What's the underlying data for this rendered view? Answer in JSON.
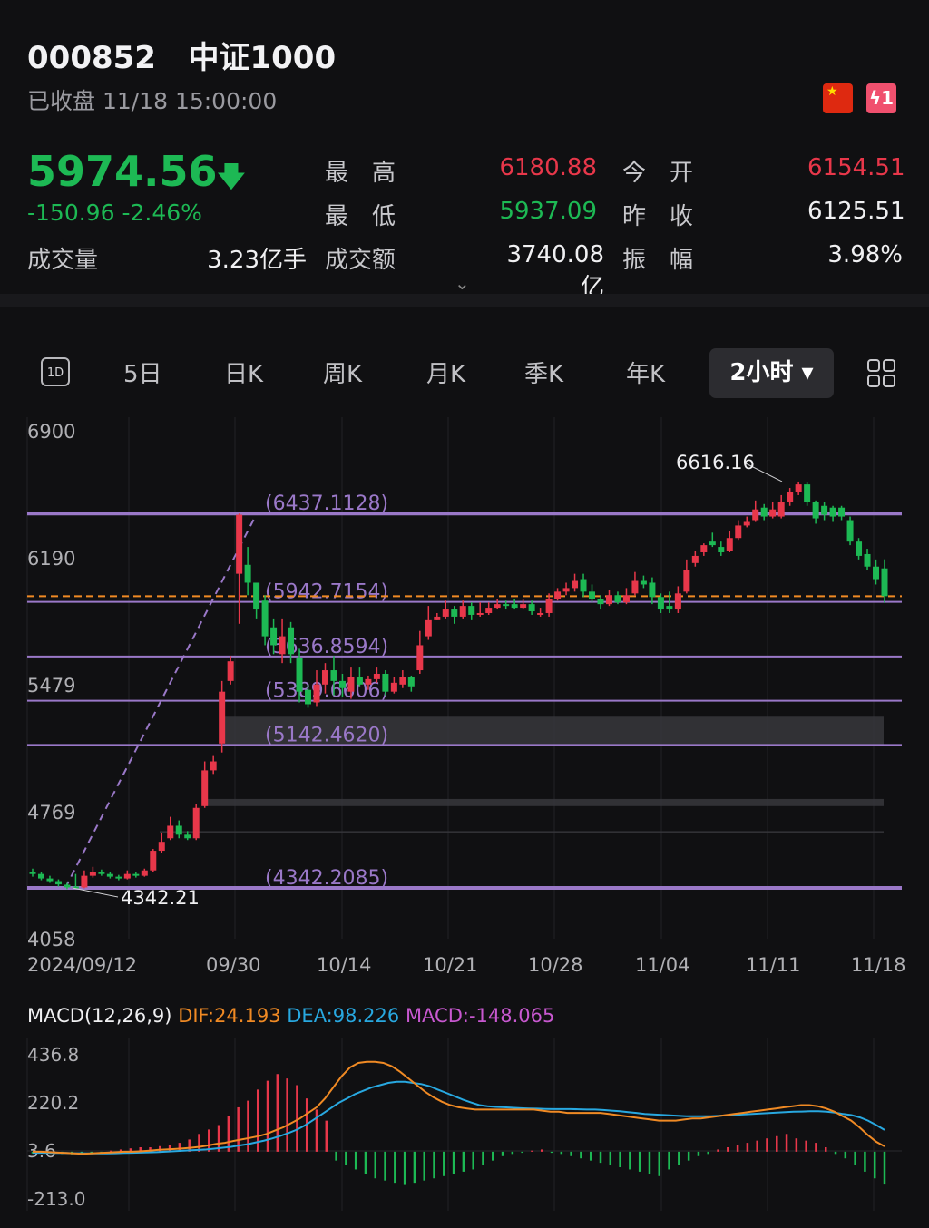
{
  "header": {
    "code": "000852",
    "name": "中证1000",
    "status": "已收盘 11/18 15:00:00",
    "hot_badge": "ϟ1"
  },
  "quote": {
    "price": "5974.56",
    "change": "-150.96 -2.46%",
    "stats": [
      {
        "label": "最　高",
        "value": "6180.88",
        "color": "red"
      },
      {
        "label": "今　开",
        "value": "6154.51",
        "color": "red"
      },
      {
        "label": "最　低",
        "value": "5937.09",
        "color": "green"
      },
      {
        "label": "昨　收",
        "value": "6125.51",
        "color": "white"
      },
      {
        "label": "成交量",
        "value": "3.23亿手",
        "color": "white"
      },
      {
        "label": "成交额",
        "value": "3740.08亿",
        "color": "white"
      },
      {
        "label": "振　幅",
        "value": "3.98%",
        "color": "white"
      }
    ]
  },
  "tabs": {
    "icon_1d": "1D",
    "items": [
      "5日",
      "日K",
      "周K",
      "月K",
      "季K",
      "年K"
    ],
    "selected": "2小时"
  },
  "colors": {
    "up": "#e8374a",
    "down": "#1db954",
    "dif": "#f08a24",
    "dea": "#28a8e0",
    "macd": "#c858d0",
    "level": "#9a78c8",
    "close_line": "#f08a24"
  },
  "chart_data": {
    "type": "candlestick",
    "y_ticks": [
      "6900",
      "6190",
      "5479",
      "4769",
      "4058"
    ],
    "ylim": [
      4058,
      6900
    ],
    "x_ticks": [
      "2024/09/12",
      "09/30",
      "10/14",
      "10/21",
      "10/28",
      "11/04",
      "11/11",
      "11/18"
    ],
    "high_label": "6616.16",
    "low_label": "4342.21",
    "current_price": 5974.56,
    "levels": [
      {
        "label": "(6437.1128)",
        "value": 6437.1128
      },
      {
        "label": "(5942.7154)",
        "value": 5942.7154
      },
      {
        "label": "(5636.8594)",
        "value": 5636.8594
      },
      {
        "label": "(5389.6606)",
        "value": 5389.6606
      },
      {
        "label": "(5142.4620)",
        "value": 5142.462
      },
      {
        "label": "(4342.2085)",
        "value": 4342.2085
      }
    ],
    "candles": [
      [
        4430,
        4420,
        4450,
        4405
      ],
      [
        4420,
        4395,
        4430,
        4385
      ],
      [
        4395,
        4380,
        4410,
        4370
      ],
      [
        4380,
        4362,
        4390,
        4350
      ],
      [
        4360,
        4345,
        4370,
        4335
      ],
      [
        4350,
        4342,
        4420,
        4342
      ],
      [
        4345,
        4410,
        4440,
        4340
      ],
      [
        4410,
        4430,
        4460,
        4400
      ],
      [
        4430,
        4420,
        4445,
        4410
      ],
      [
        4420,
        4405,
        4430,
        4395
      ],
      [
        4405,
        4395,
        4415,
        4385
      ],
      [
        4395,
        4420,
        4440,
        4390
      ],
      [
        4420,
        4410,
        4430,
        4400
      ],
      [
        4410,
        4440,
        4450,
        4405
      ],
      [
        4440,
        4550,
        4560,
        4430
      ],
      [
        4550,
        4600,
        4650,
        4540
      ],
      [
        4620,
        4690,
        4740,
        4610
      ],
      [
        4690,
        4640,
        4720,
        4620
      ],
      [
        4640,
        4620,
        4660,
        4610
      ],
      [
        4620,
        4790,
        4810,
        4610
      ],
      [
        4800,
        5000,
        5050,
        4790
      ],
      [
        5000,
        5050,
        5080,
        4980
      ],
      [
        5150,
        5440,
        5500,
        5100
      ],
      [
        5500,
        5610,
        5640,
        5480
      ],
      [
        6100,
        6430,
        6437,
        5820
      ],
      [
        6150,
        6050,
        6250,
        5980
      ],
      [
        6050,
        5900,
        6000,
        5850
      ],
      [
        5950,
        5750,
        5980,
        5700
      ],
      [
        5800,
        5700,
        5850,
        5650
      ],
      [
        5650,
        5750,
        5850,
        5600
      ],
      [
        5800,
        5650,
        5830,
        5600
      ],
      [
        5630,
        5440,
        5680,
        5380
      ],
      [
        5450,
        5370,
        5480,
        5350
      ],
      [
        5380,
        5480,
        5560,
        5360
      ],
      [
        5480,
        5560,
        5600,
        5430
      ],
      [
        5560,
        5500,
        5640,
        5420
      ],
      [
        5500,
        5460,
        5540,
        5410
      ],
      [
        5440,
        5520,
        5580,
        5400
      ],
      [
        5520,
        5480,
        5580,
        5470
      ],
      [
        5480,
        5510,
        5530,
        5450
      ],
      [
        5510,
        5540,
        5580,
        5490
      ],
      [
        5540,
        5440,
        5560,
        5420
      ],
      [
        5440,
        5490,
        5520,
        5430
      ],
      [
        5480,
        5520,
        5560,
        5460
      ],
      [
        5520,
        5470,
        5530,
        5440
      ],
      [
        5560,
        5700,
        5780,
        5540
      ],
      [
        5750,
        5840,
        5920,
        5730
      ],
      [
        5840,
        5860,
        5880,
        5840
      ],
      [
        5860,
        5900,
        5950,
        5850
      ],
      [
        5900,
        5860,
        5920,
        5820
      ],
      [
        5860,
        5920,
        5950,
        5850
      ],
      [
        5920,
        5870,
        5940,
        5840
      ],
      [
        5870,
        5880,
        5940,
        5860
      ],
      [
        5880,
        5910,
        5940,
        5870
      ],
      [
        5910,
        5930,
        5960,
        5900
      ],
      [
        5930,
        5920,
        5950,
        5900
      ],
      [
        5930,
        5910,
        5960,
        5900
      ],
      [
        5910,
        5930,
        5960,
        5900
      ],
      [
        5930,
        5890,
        5950,
        5870
      ],
      [
        5870,
        5880,
        5910,
        5860
      ],
      [
        5880,
        5960,
        5990,
        5860
      ],
      [
        5960,
        6000,
        6020,
        5950
      ],
      [
        6000,
        6020,
        6050,
        5980
      ],
      [
        6020,
        6060,
        6100,
        6000
      ],
      [
        6070,
        6000,
        6100,
        5970
      ],
      [
        6000,
        5960,
        6040,
        5940
      ],
      [
        5960,
        5930,
        5980,
        5900
      ],
      [
        5930,
        5980,
        6010,
        5920
      ],
      [
        5980,
        5940,
        6000,
        5930
      ],
      [
        5940,
        5980,
        6020,
        5930
      ],
      [
        5990,
        6060,
        6110,
        5980
      ],
      [
        6060,
        6040,
        6090,
        6020
      ],
      [
        6050,
        5970,
        6080,
        5930
      ],
      [
        5970,
        5900,
        5990,
        5880
      ],
      [
        5920,
        5900,
        6000,
        5880
      ],
      [
        5900,
        5990,
        6030,
        5880
      ],
      [
        6000,
        6120,
        6180,
        5990
      ],
      [
        6160,
        6200,
        6230,
        6140
      ],
      [
        6220,
        6260,
        6270,
        6200
      ],
      [
        6280,
        6260,
        6330,
        6250
      ],
      [
        6250,
        6220,
        6280,
        6200
      ],
      [
        6230,
        6300,
        6340,
        6220
      ],
      [
        6300,
        6370,
        6400,
        6290
      ],
      [
        6370,
        6390,
        6420,
        6360
      ],
      [
        6400,
        6460,
        6510,
        6390
      ],
      [
        6470,
        6420,
        6490,
        6400
      ],
      [
        6420,
        6460,
        6500,
        6410
      ],
      [
        6420,
        6500,
        6540,
        6410
      ],
      [
        6500,
        6560,
        6580,
        6480
      ],
      [
        6560,
        6600,
        6616,
        6540
      ],
      [
        6600,
        6500,
        6610,
        6480
      ],
      [
        6500,
        6410,
        6510,
        6380
      ],
      [
        6480,
        6430,
        6500,
        6400
      ],
      [
        6470,
        6420,
        6480,
        6390
      ],
      [
        6470,
        6420,
        6480,
        6400
      ],
      [
        6400,
        6280,
        6420,
        6260
      ],
      [
        6280,
        6200,
        6300,
        6180
      ],
      [
        6210,
        6140,
        6240,
        6120
      ],
      [
        6140,
        6070,
        6180,
        6040
      ],
      [
        6130,
        5974.56,
        6180.88,
        5937.09
      ]
    ],
    "macd": {
      "label": "MACD(12,26,9)",
      "dif_label": "DIF:24.193",
      "dea_label": "DEA:98.226",
      "macd_label": "MACD:-148.065",
      "y_ticks": [
        "436.8",
        "220.2",
        "3.6",
        "-213.0"
      ],
      "ylim": [
        -213.0,
        436.8
      ],
      "dif": [
        0,
        0,
        -2,
        -4,
        -6,
        -8,
        -10,
        -8,
        -6,
        -4,
        -2,
        0,
        0,
        2,
        5,
        8,
        10,
        12,
        15,
        18,
        22,
        28,
        35,
        40,
        48,
        55,
        62,
        70,
        80,
        95,
        110,
        130,
        150,
        175,
        200,
        240,
        290,
        340,
        380,
        400,
        405,
        405,
        400,
        385,
        360,
        330,
        300,
        270,
        245,
        225,
        210,
        200,
        195,
        190,
        190,
        190,
        190,
        190,
        190,
        190,
        190,
        185,
        180,
        180,
        175,
        175,
        175,
        175,
        175,
        170,
        165,
        160,
        155,
        150,
        145,
        140,
        140,
        140,
        145,
        150,
        150,
        155,
        160,
        165,
        170,
        175,
        180,
        185,
        190,
        195,
        200,
        205,
        210,
        210,
        205,
        195,
        180,
        160,
        140,
        110,
        75,
        45,
        24.2
      ],
      "dea": [
        -5,
        -5,
        -5,
        -6,
        -6,
        -7,
        -7,
        -8,
        -8,
        -8,
        -7,
        -6,
        -5,
        -4,
        -3,
        -2,
        0,
        2,
        4,
        6,
        8,
        10,
        14,
        18,
        22,
        28,
        34,
        42,
        50,
        60,
        72,
        85,
        100,
        120,
        145,
        170,
        195,
        220,
        240,
        260,
        275,
        290,
        300,
        310,
        315,
        315,
        310,
        305,
        295,
        280,
        265,
        250,
        235,
        222,
        210,
        205,
        202,
        200,
        198,
        196,
        195,
        194,
        193,
        192,
        192,
        192,
        191,
        190,
        190,
        188,
        185,
        182,
        178,
        175,
        170,
        168,
        166,
        164,
        162,
        160,
        160,
        160,
        160,
        162,
        164,
        166,
        168,
        170,
        172,
        174,
        176,
        178,
        180,
        181,
        182,
        182,
        180,
        176,
        170,
        165,
        155,
        140,
        120,
        98.2
      ],
      "hist": [
        -8,
        -6,
        -8,
        -10,
        -12,
        -8,
        -5,
        -6,
        5,
        10,
        15,
        20,
        20,
        25,
        30,
        40,
        55,
        80,
        100,
        120,
        160,
        200,
        230,
        280,
        320,
        350,
        330,
        300,
        240,
        190,
        140,
        -40,
        -60,
        -80,
        -100,
        -120,
        -130,
        -140,
        -150,
        -140,
        -130,
        -120,
        -110,
        -100,
        -90,
        -80,
        -60,
        -40,
        -20,
        -10,
        -5,
        5,
        10,
        -5,
        -10,
        -20,
        -30,
        -40,
        -50,
        -60,
        -70,
        -80,
        -90,
        -100,
        -110,
        -80,
        -60,
        -40,
        -20,
        -10,
        10,
        20,
        30,
        40,
        50,
        60,
        70,
        80,
        60,
        50,
        40,
        20,
        -10,
        -30,
        -60,
        -90,
        -120,
        -148
      ]
    }
  }
}
